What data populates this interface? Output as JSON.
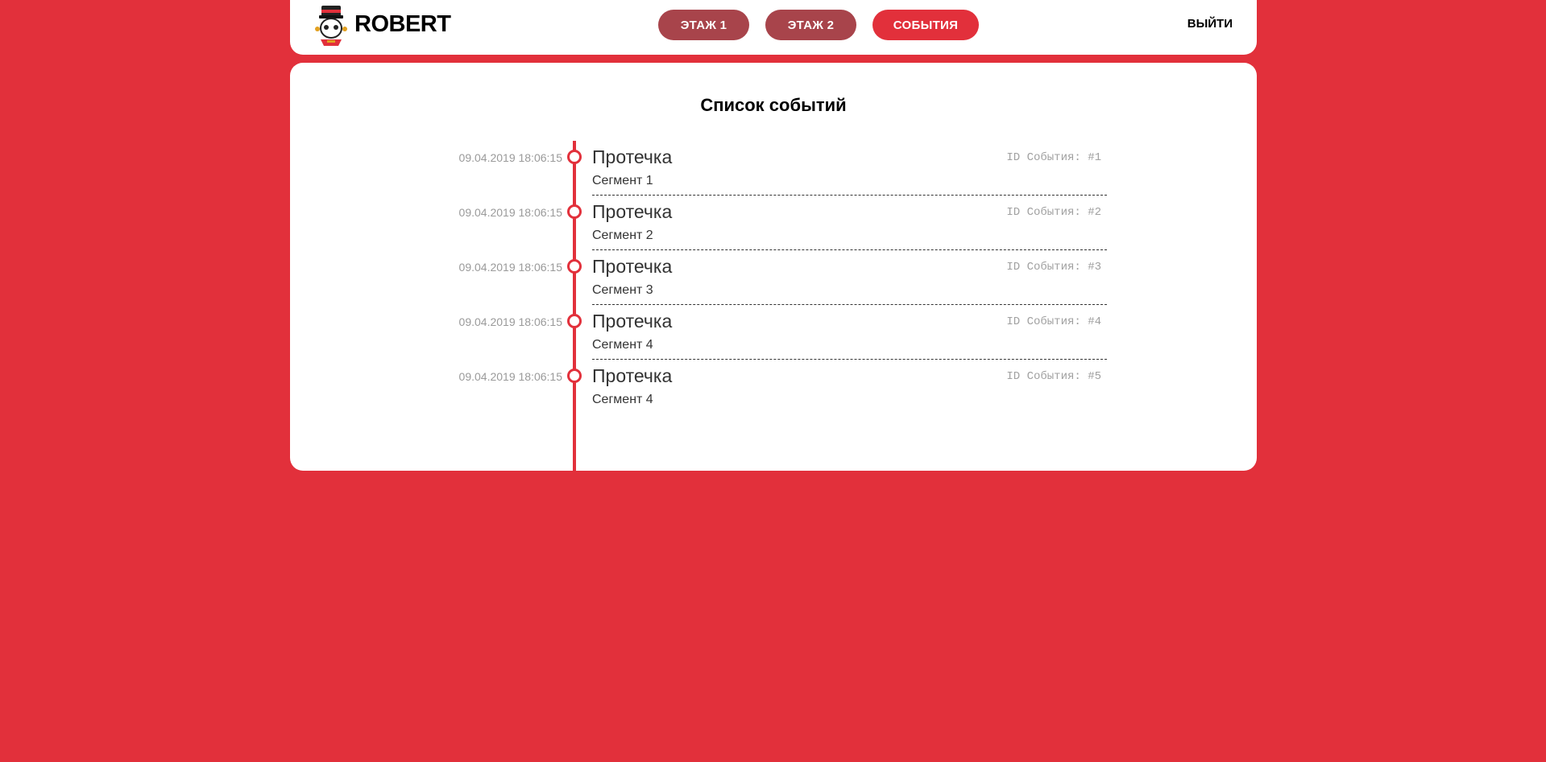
{
  "header": {
    "brand": "ROBERT",
    "nav": [
      {
        "label": "ЭТАЖ 1"
      },
      {
        "label": "ЭТАЖ 2"
      },
      {
        "label": "СОБЫТИЯ"
      }
    ],
    "logout_label": "ВЫЙТИ"
  },
  "main": {
    "title": "Список событий",
    "events": [
      {
        "time": "09.04.2019 18:06:15",
        "title": "Протечка",
        "segment": "Сегмент 1",
        "id_label": "ID События: #1"
      },
      {
        "time": "09.04.2019 18:06:15",
        "title": "Протечка",
        "segment": "Сегмент 2",
        "id_label": "ID События: #2"
      },
      {
        "time": "09.04.2019 18:06:15",
        "title": "Протечка",
        "segment": "Сегмент 3",
        "id_label": "ID События: #3"
      },
      {
        "time": "09.04.2019 18:06:15",
        "title": "Протечка",
        "segment": "Сегмент 4",
        "id_label": "ID События: #4"
      },
      {
        "time": "09.04.2019 18:06:15",
        "title": "Протечка",
        "segment": "Сегмент 4",
        "id_label": "ID События: #5"
      }
    ]
  },
  "colors": {
    "background": "#e2303b",
    "nav_inactive": "#a8444b",
    "nav_active": "#e2303b"
  },
  "icons": {
    "logo": "robot-bellhop-logo-icon",
    "timeline_marker": "circle-marker-icon"
  }
}
